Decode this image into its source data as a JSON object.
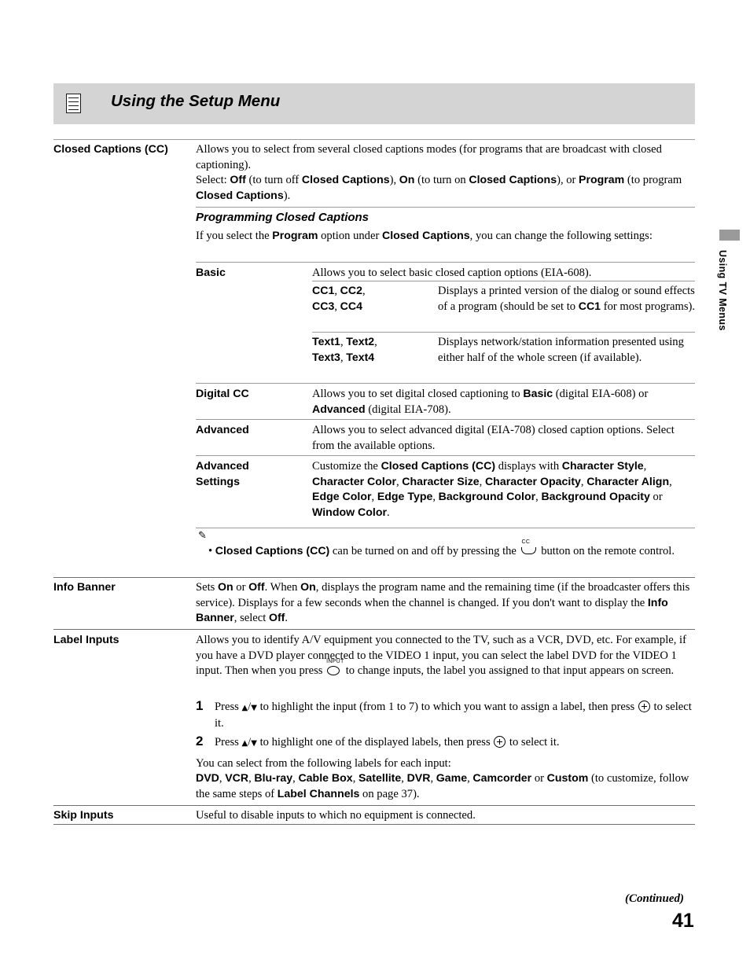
{
  "header": {
    "title": "Using the Setup Menu",
    "icon": "menu-list-icon"
  },
  "side_tab_text": "Using TV Menus",
  "sections": {
    "closed_captions": {
      "label": "Closed Captions (CC)",
      "body_1": "Allows you to select from several closed captions modes (for programs that are broadcast with closed captioning).",
      "body_2_pre": "Select: ",
      "body_2": "Off (to turn off Closed Captions), On (to turn on Closed Captions), or Program (to program Closed Captions).",
      "subhead": "Programming Closed Captions",
      "subbody": "If you select the Program option under Closed Captions, you can change the following settings:",
      "rows": [
        {
          "label": "Basic",
          "desc": "Allows you to select basic closed caption options (EIA-608).",
          "sub_rows": [
            {
              "term": "CC1, CC2, CC3, CC4",
              "desc": "Displays a printed version of the dialog or sound effects of a program (should be set to CC1 for most programs)."
            },
            {
              "term": "Text1, Text2, Text3, Text4",
              "desc": "Displays network/station information presented using either half of the whole screen (if available)."
            }
          ]
        },
        {
          "label": "Digital CC",
          "desc": "Allows you to set digital closed captioning to Basic (digital EIA-608) or Advanced (digital EIA-708)."
        },
        {
          "label": "Advanced",
          "desc": "Allows you to select advanced digital (EIA-708) closed caption options. Select from the available options."
        },
        {
          "label": "Advanced Settings",
          "desc": "Customize the Closed Captions (CC) displays with Character Style, Character Color, Character Size, Character Opacity, Character Align, Edge Color, Edge Type, Background Color, Background Opacity or Window Color."
        }
      ],
      "note": "• Closed Captions (CC) can be turned on and off by pressing the [CC] button on the remote control.",
      "note_icon": "pencil-note-icon"
    },
    "info_banner": {
      "label": "Info Banner",
      "body": "Sets On or Off. When On, displays the program name and the remaining time (if the broadcaster offers this service). Displays for a few seconds when the channel is changed. If you don't want to display the Info Banner, select Off."
    },
    "label_inputs": {
      "label": "Label Inputs",
      "body": "Allows you to identify A/V equipment you connected to the TV, such as a VCR, DVD, etc. For example, if you have a DVD player connected to the VIDEO 1 input, you can select the label DVD for the VIDEO 1 input. Then when you press [INPUT] to change inputs, the label you assigned to that input appears on screen.",
      "steps": [
        {
          "number": "1",
          "text": "Press ↑/↓ to highlight the input (from 1 to 7) to which you want to assign a label, then press [+] to select it."
        },
        {
          "number": "2",
          "text": "Press ↑/↓ to highlight one of the displayed labels, then press [+] to select it."
        }
      ],
      "after_steps": "You can select from the following labels for each input:",
      "labels_line": "DVD, VCR, Blu-ray, Cable Box, Satellite, DVR, Game, Camcorder or Custom (to customize, follow the same steps of Label Channels on page 37)."
    },
    "skip_inputs": {
      "label": "Skip Inputs",
      "body": "Useful to disable inputs to which no equipment is connected."
    }
  },
  "footer": {
    "continued": "(Continued)",
    "page_number": "41"
  }
}
